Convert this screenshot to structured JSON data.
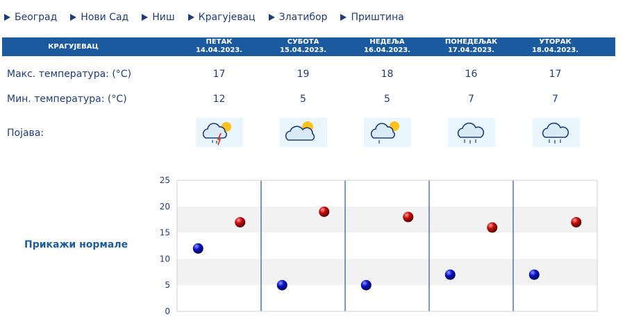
{
  "nav": {
    "cities": [
      "Београд",
      "Нови Сад",
      "Ниш",
      "Крагујевац",
      "Златибор",
      "Приштина"
    ]
  },
  "table": {
    "city": "КРАГУЈЕВАЦ",
    "days": [
      {
        "name": "ПЕТАК",
        "date": "14.04.2023.",
        "max": "17",
        "min": "12",
        "icon": "thunderstorm-sun-icon"
      },
      {
        "name": "СУБОТА",
        "date": "15.04.2023.",
        "max": "19",
        "min": "5",
        "icon": "sun-cloud-icon"
      },
      {
        "name": "НЕДЕЉА",
        "date": "16.04.2023.",
        "max": "18",
        "min": "5",
        "icon": "sun-cloud-rain-icon"
      },
      {
        "name": "ПОНЕДЕЉАК",
        "date": "17.04.2023.",
        "max": "16",
        "min": "7",
        "icon": "cloud-rain-icon"
      },
      {
        "name": "УТОРАК",
        "date": "18.04.2023.",
        "max": "17",
        "min": "7",
        "icon": "cloud-rain-icon"
      }
    ],
    "row_labels": {
      "max": "Макс. температура: (°C)",
      "min": "Мин. температура: (°C)",
      "phenomenon": "Појава:"
    }
  },
  "normals_link": "Прикажи нормале",
  "colors": {
    "band": "#1c5aa0",
    "text": "#1f3c78",
    "min_marker": "#0b10c8",
    "max_marker": "#c80a0a"
  },
  "chart_data": {
    "type": "scatter",
    "title": "",
    "xlabel": "",
    "ylabel": "",
    "ylim": [
      0,
      25
    ],
    "yticks": [
      0,
      5,
      10,
      15,
      20,
      25
    ],
    "grid": true,
    "categories": [
      "14.04.2023.",
      "15.04.2023.",
      "16.04.2023.",
      "17.04.2023.",
      "18.04.2023."
    ],
    "series": [
      {
        "values": [
          12,
          5,
          5,
          7,
          7
        ],
        "color": "#0b10c8"
      },
      {
        "values": [
          17,
          19,
          18,
          16,
          17
        ],
        "color": "#c80a0a"
      }
    ]
  }
}
